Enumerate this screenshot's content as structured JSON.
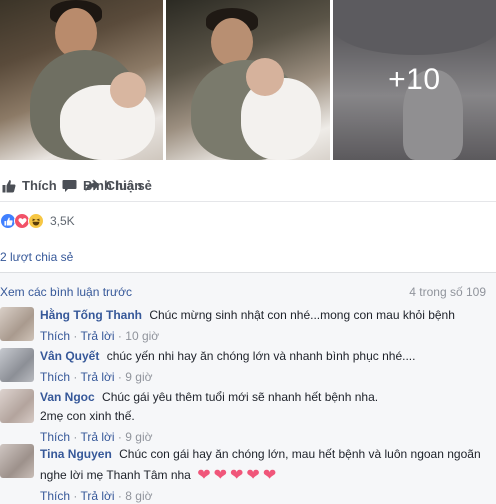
{
  "photos": {
    "more_count": "+10"
  },
  "actions": {
    "like_label": "Thích",
    "comment_label": "Bình luận",
    "share_label": "Chia sẻ"
  },
  "reactions": {
    "icons": [
      "like-reaction",
      "love-reaction",
      "haha-reaction"
    ],
    "count": "3,5K"
  },
  "shares": {
    "label": "2 lượt chia sẻ"
  },
  "comments": {
    "view_previous": "Xem các bình luận trước",
    "count_label": "4 trong số 109",
    "items": [
      {
        "name": "Hằng Tống Thanh",
        "text": "Chúc mừng sinh nhật con nhé...mong con mau khỏi bệnh",
        "like": "Thích",
        "reply": "Trả lời",
        "time": "10 giờ"
      },
      {
        "name": "Vân Quyết",
        "text": "chúc yến nhi hay ăn chóng lớn và nhanh bình phục nhé....",
        "like": "Thích",
        "reply": "Trả lời",
        "time": "9 giờ"
      },
      {
        "name": "Van Ngoc",
        "text": "Chúc gái yêu thêm tuổi mới sẽ nhanh hết bệnh nha.",
        "text2": "2mẹ con xinh thế.",
        "like": "Thích",
        "reply": "Trả lời",
        "time": "9 giờ"
      },
      {
        "name": "Tina Nguyen",
        "text": "Chúc con gái hay ăn chóng lớn, mau hết bệnh và luôn ngoan ngoãn nghe lời mẹ Thanh Tâm nha",
        "like": "Thích",
        "reply": "Trả lời",
        "time": "8 giờ"
      }
    ]
  },
  "separator": "·",
  "colors": {
    "link": "#365899",
    "muted": "#90949c",
    "like_blue": "#4080ff",
    "love_red": "#f25268",
    "haha_yellow": "#f7c744"
  }
}
